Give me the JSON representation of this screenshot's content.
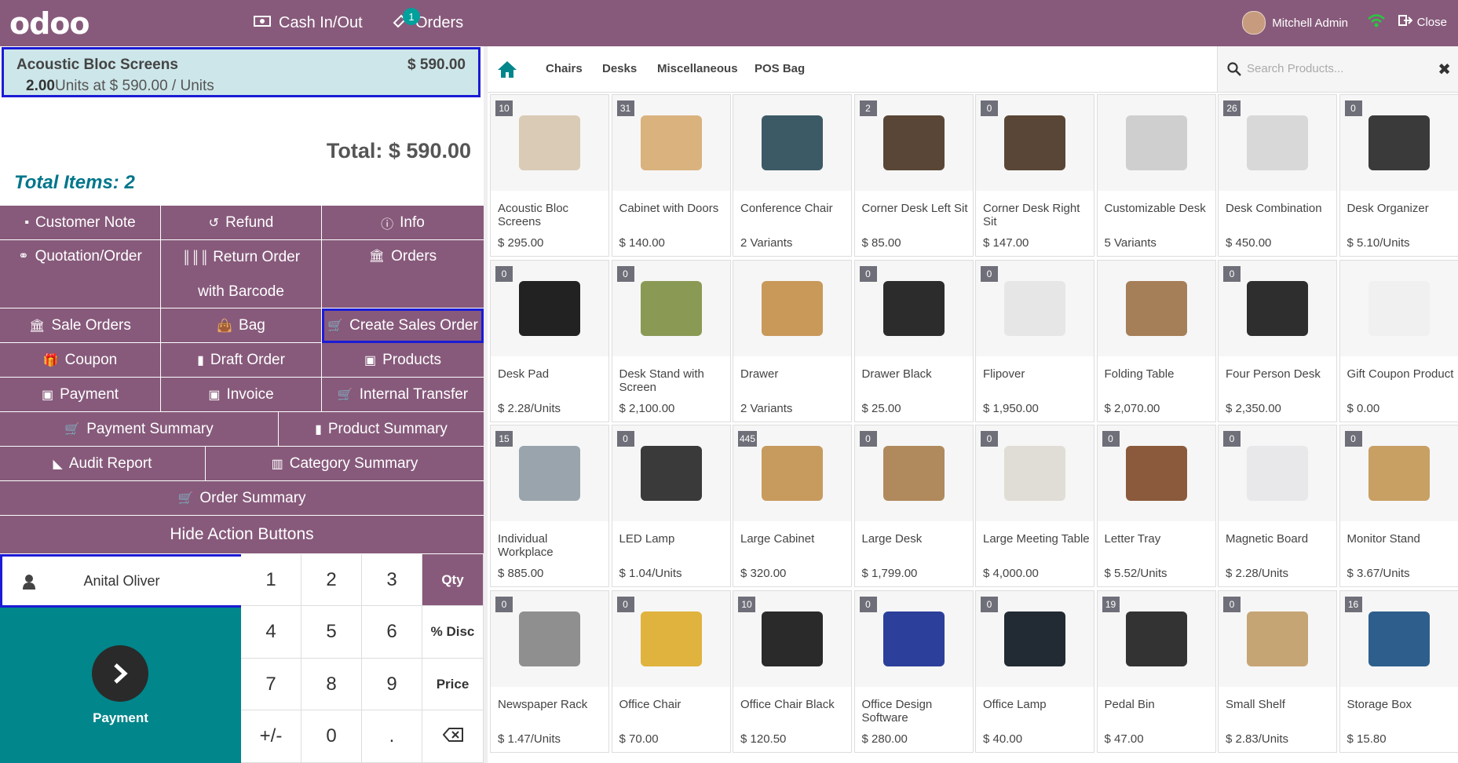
{
  "topbar": {
    "logo": "odoo",
    "cash_label": "Cash In/Out",
    "orders_label": "Orders",
    "orders_badge": "1",
    "user_name": "Mitchell Admin",
    "close_label": "Close"
  },
  "orderline": {
    "product": "Acoustic Bloc Screens",
    "price": "$ 590.00",
    "qty": "2.00",
    "unit_text": "Units at $ 590.00 / Units"
  },
  "summary": {
    "total": "Total: $ 590.00",
    "total_items": "Total Items: 2"
  },
  "actions": {
    "customer_note": "Customer Note",
    "refund": "Refund",
    "info": "Info",
    "quotation": "Quotation/Order",
    "return_barcode": "Return Order with Barcode",
    "orders": "Orders",
    "sale_orders": "Sale Orders",
    "bag": "Bag",
    "create_sales_order": "Create Sales Order",
    "coupon": "Coupon",
    "draft_order": "Draft Order",
    "products": "Products",
    "payment": "Payment",
    "invoice": "Invoice",
    "internal_transfer": "Internal Transfer",
    "payment_summary": "Payment Summary",
    "product_summary": "Product Summary",
    "audit_report": "Audit Report",
    "category_summary": "Category Summary",
    "order_summary": "Order Summary",
    "hide_actions": "Hide Action Buttons"
  },
  "customer": {
    "name": "Anital Oliver"
  },
  "pay": {
    "label": "Payment"
  },
  "numpad": {
    "k1": "1",
    "k2": "2",
    "k3": "3",
    "qty": "Qty",
    "k4": "4",
    "k5": "5",
    "k6": "6",
    "disc": "% Disc",
    "k7": "7",
    "k8": "8",
    "k9": "9",
    "price": "Price",
    "sign": "+/-",
    "k0": "0",
    "dot": "."
  },
  "categories": [
    "Chairs",
    "Desks",
    "Miscellaneous",
    "POS Bag"
  ],
  "search": {
    "placeholder": "Search Products..."
  },
  "products": [
    {
      "name": "Acoustic Bloc Screens",
      "price": "$ 295.00",
      "qty": "10",
      "img_color": "#d9cbb5"
    },
    {
      "name": "Cabinet with Doors",
      "price": "$ 140.00",
      "qty": "31",
      "img_color": "#d9b27e"
    },
    {
      "name": "Conference Chair",
      "price": "2 Variants",
      "qty": "",
      "img_color": "#3c5a66"
    },
    {
      "name": "Corner Desk Left Sit",
      "price": "$ 85.00",
      "qty": "2",
      "img_color": "#5a4636"
    },
    {
      "name": "Corner Desk Right Sit",
      "price": "$ 147.00",
      "qty": "0",
      "img_color": "#5a4636"
    },
    {
      "name": "Customizable Desk",
      "price": "5 Variants",
      "qty": "",
      "img_color": "#cfcfcf"
    },
    {
      "name": "Desk Combination",
      "price": "$ 450.00",
      "qty": "26",
      "img_color": "#d8d8d8"
    },
    {
      "name": "Desk Organizer",
      "price": "$ 5.10/Units",
      "qty": "0",
      "img_color": "#3a3a3a"
    },
    {
      "name": "Desk Pad",
      "price": "$ 2.28/Units",
      "qty": "0",
      "img_color": "#222222"
    },
    {
      "name": "Desk Stand with Screen",
      "price": "$ 2,100.00",
      "qty": "0",
      "img_color": "#8a9a55"
    },
    {
      "name": "Drawer",
      "price": "2 Variants",
      "qty": "",
      "img_color": "#c9995a"
    },
    {
      "name": "Drawer Black",
      "price": "$ 25.00",
      "qty": "0",
      "img_color": "#2c2c2c"
    },
    {
      "name": "Flipover",
      "price": "$ 1,950.00",
      "qty": "0",
      "img_color": "#e6e6e6"
    },
    {
      "name": "Folding Table",
      "price": "$ 2,070.00",
      "qty": "",
      "img_color": "#a57f58"
    },
    {
      "name": "Four Person Desk",
      "price": "$ 2,350.00",
      "qty": "0",
      "img_color": "#2e2e2e"
    },
    {
      "name": "Gift Coupon Product",
      "price": "$ 0.00",
      "qty": "",
      "img_color": "#f0f0f0"
    },
    {
      "name": "Individual Workplace",
      "price": "$ 885.00",
      "qty": "15",
      "img_color": "#9aa4ad"
    },
    {
      "name": "LED Lamp",
      "price": "$ 1.04/Units",
      "qty": "0",
      "img_color": "#3a3a3a"
    },
    {
      "name": "Large Cabinet",
      "price": "$ 320.00",
      "qty": "445",
      "img_color": "#c79a5e"
    },
    {
      "name": "Large Desk",
      "price": "$ 1,799.00",
      "qty": "0",
      "img_color": "#b08a5c"
    },
    {
      "name": "Large Meeting Table",
      "price": "$ 4,000.00",
      "qty": "0",
      "img_color": "#e0ddd6"
    },
    {
      "name": "Letter Tray",
      "price": "$ 5.52/Units",
      "qty": "0",
      "img_color": "#8b5a3c"
    },
    {
      "name": "Magnetic Board",
      "price": "$ 2.28/Units",
      "qty": "0",
      "img_color": "#e8e8ea"
    },
    {
      "name": "Monitor Stand",
      "price": "$ 3.67/Units",
      "qty": "0",
      "img_color": "#c8a064"
    },
    {
      "name": "Newspaper Rack",
      "price": "$ 1.47/Units",
      "qty": "0",
      "img_color": "#8f8f8f"
    },
    {
      "name": "Office Chair",
      "price": "$ 70.00",
      "qty": "0",
      "img_color": "#e0b33e"
    },
    {
      "name": "Office Chair Black",
      "price": "$ 120.50",
      "qty": "10",
      "img_color": "#2a2a2a"
    },
    {
      "name": "Office Design Software",
      "price": "$ 280.00",
      "qty": "0",
      "img_color": "#2c3f9a"
    },
    {
      "name": "Office Lamp",
      "price": "$ 40.00",
      "qty": "0",
      "img_color": "#222a33"
    },
    {
      "name": "Pedal Bin",
      "price": "$ 47.00",
      "qty": "19",
      "img_color": "#333333"
    },
    {
      "name": "Small Shelf",
      "price": "$ 2.83/Units",
      "qty": "0",
      "img_color": "#c6a575"
    },
    {
      "name": "Storage Box",
      "price": "$ 15.80",
      "qty": "16",
      "img_color": "#2e5f8c"
    }
  ]
}
